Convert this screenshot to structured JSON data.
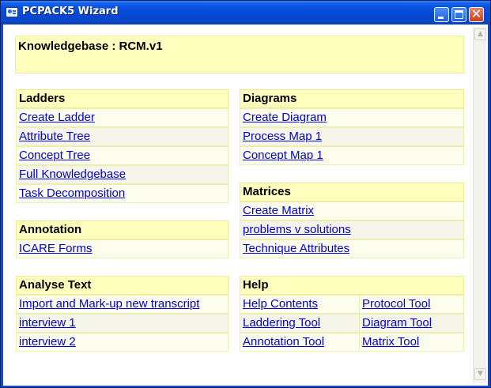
{
  "window": {
    "title": "PCPACK5 Wizard",
    "title_icon": "app-window-icon",
    "controls": {
      "minimize": "minimize-icon",
      "maximize": "maximize-icon",
      "close": "close-icon",
      "close_glyph": "✕"
    }
  },
  "knowledgebase": {
    "label": "Knowledgebase : RCM.v1"
  },
  "ladders": {
    "title": "Ladders",
    "items": [
      "Create Ladder",
      "Attribute Tree",
      "Concept Tree",
      "Full Knowledgebase",
      "Task Decomposition"
    ]
  },
  "annotation": {
    "title": "Annotation",
    "items": [
      "ICARE Forms"
    ]
  },
  "analyse_text": {
    "title": "Analyse Text",
    "items": [
      "Import and Mark-up new transcript",
      "interview 1",
      "interview 2"
    ]
  },
  "diagrams": {
    "title": "Diagrams",
    "items": [
      "Create Diagram",
      "Process Map 1",
      "Concept Map 1"
    ]
  },
  "matrices": {
    "title": "Matrices",
    "items": [
      "Create Matrix",
      "problems v solutions",
      "Technique Attributes"
    ]
  },
  "help": {
    "title": "Help",
    "items": [
      [
        "Help Contents",
        "Protocol Tool"
      ],
      [
        "Laddering Tool",
        "Diagram Tool"
      ],
      [
        "Annotation Tool",
        "Matrix Tool"
      ]
    ]
  },
  "scrollbar": {
    "up_glyph": "▲",
    "down_glyph": "▼",
    "up_icon": "scroll-up-arrow-icon",
    "down_icon": "scroll-down-arrow-icon"
  },
  "colors": {
    "titlebar": "#0549d6",
    "panel_header": "#ffffbe",
    "row_background": "#fdfdee",
    "link": "#0000d6"
  }
}
